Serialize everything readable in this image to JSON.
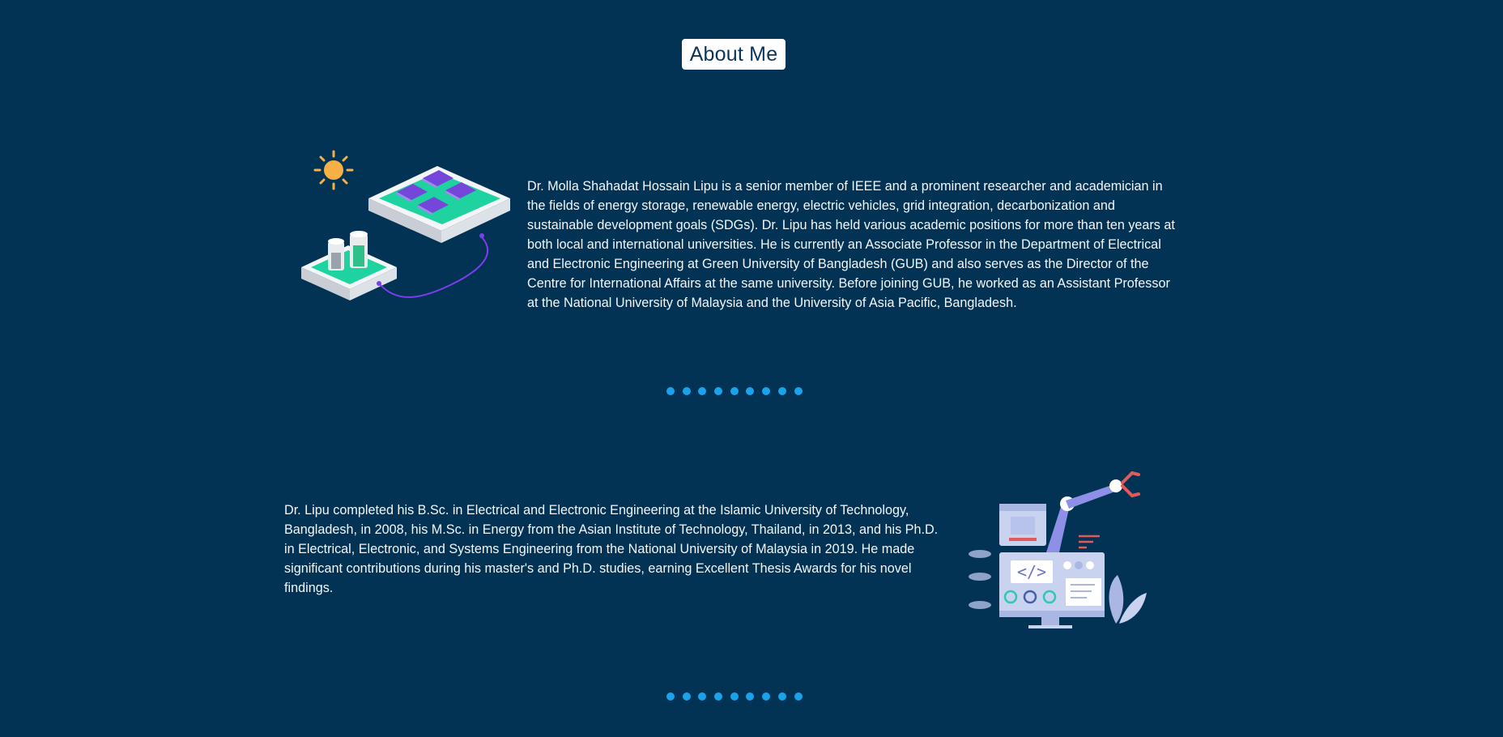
{
  "section": {
    "title": "About Me"
  },
  "paragraphs": [
    {
      "text": "Dr. Molla Shahadat Hossain Lipu is a senior member of IEEE and a prominent researcher and academician in the fields of energy storage, renewable energy, electric vehicles, grid integration, decarbonization and sustainable development goals (SDGs). Dr. Lipu has held various academic positions for more than ten years at both local and international universities. He is currently an Associate Professor in the Department of Electrical and Electronic Engineering at Green University of Bangladesh (GUB) and also serves as the Director of the Centre for International Affairs at the same university. Before joining GUB, he worked as an Assistant Professor at the National University of Malaysia and the University of Asia Pacific, Bangladesh."
    },
    {
      "text": "Dr. Lipu completed his B.Sc. in Electrical and Electronic Engineering at the Islamic University of Technology, Bangladesh, in 2008, his M.Sc. in Energy from the Asian Institute of Technology, Thailand, in 2013, and his Ph.D. in Electrical, Electronic, and Systems Engineering from the National University of Malaysia in 2019. He made significant contributions during his master's and Ph.D. studies, earning Excellent Thesis Awards for his novel findings."
    }
  ],
  "illustrations": [
    {
      "icon": "solar-energy-illustration"
    },
    {
      "icon": "robot-arm-computer-illustration"
    }
  ],
  "divider_dots_count": 9,
  "colors": {
    "background": "#023354",
    "title_bg": "#ffffff",
    "title_text": "#0b3558",
    "dot": "#1aa3ea"
  }
}
